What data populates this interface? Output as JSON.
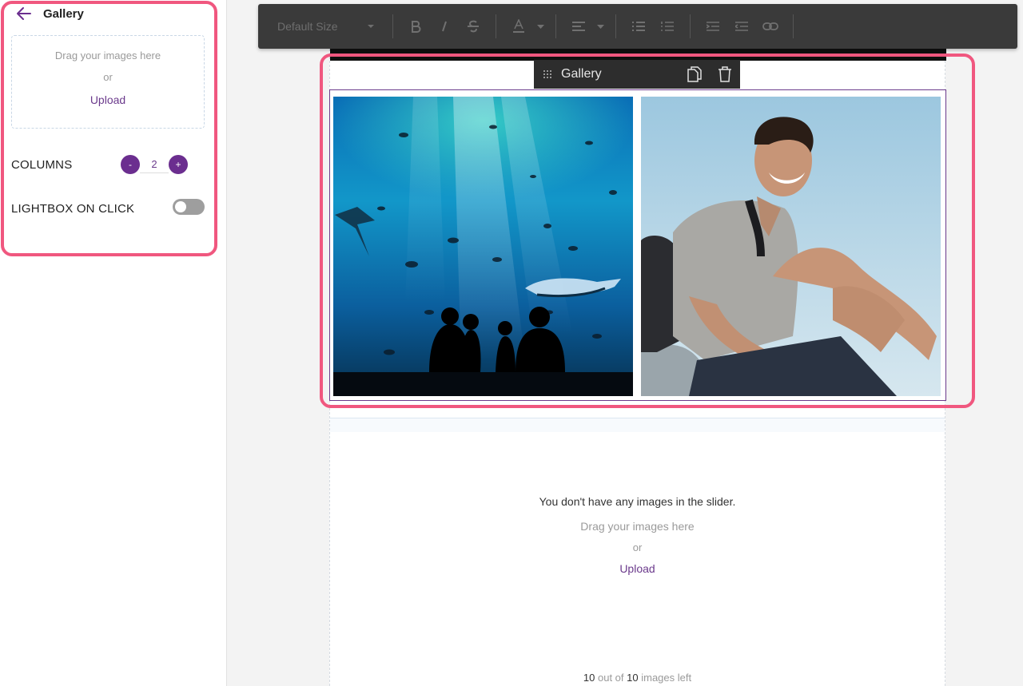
{
  "sidebar": {
    "title": "Gallery",
    "dropzone": {
      "drag_text": "Drag your images here",
      "or_text": "or",
      "upload_label": "Upload"
    },
    "columns": {
      "label": "COLUMNS",
      "minus": "-",
      "value": "2",
      "plus": "+"
    },
    "lightbox": {
      "label": "LIGHTBOX ON CLICK",
      "enabled": false
    }
  },
  "toolbar": {
    "font_size_label": "Default Size"
  },
  "gallery_block": {
    "label": "Gallery"
  },
  "slider": {
    "empty_text": "You don't have any images in the slider.",
    "drag_text": "Drag your images here",
    "or_text": "or",
    "upload_label": "Upload",
    "count_remaining": "10",
    "count_mid": "out of",
    "count_total": "10",
    "count_suffix": "images left"
  },
  "colors": {
    "accent": "#6b2e8f",
    "highlight": "#f0577f",
    "toolbar_bg": "#3a3a3a"
  },
  "icons": [
    "back-arrow-icon",
    "bold-icon",
    "italic-icon",
    "strikethrough-icon",
    "text-color-icon",
    "align-icon",
    "bullet-list-icon",
    "numbered-list-icon",
    "indent-icon",
    "outdent-icon",
    "link-icon",
    "drag-handle-icon",
    "copy-icon",
    "trash-icon"
  ]
}
